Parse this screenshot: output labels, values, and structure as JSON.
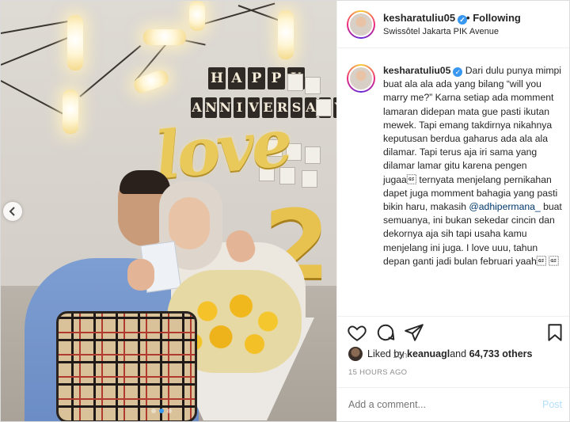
{
  "header": {
    "username": "kesharatuliu05",
    "separator": "•",
    "follow_status": "Following",
    "location": "Swissôtel Jakarta PIK Avenue"
  },
  "caption": {
    "username": "kesharatuliu05",
    "text_before_mention": "Dari dulu punya mimpi buat ala ala ada yang bilang “will you marry me?” Karna setiap ada momment lamaran didepan mata gue pasti ikutan mewek. Tapi emang takdirnya nikahnya keputusan berdua gaharus ada ala ala dilamar. Tapi terus aja iri sama yang dilamar lamar gitu karena pengen jugaa\u001d ternyata menjelang pernikahan dapet juga momment bahagia yang pasti bikin haru, makasih ",
    "mention": "@adhipermana_",
    "text_after_mention": " buat semuanya, ini bukan sekedar cincin dan dekornya aja sih tapi usaha kamu menjelang ini juga. I love uuu, tahun depan ganti jadi bulan februari yaah\u001d \u001d",
    "time": "15h"
  },
  "likes": {
    "prefix": "Liked by ",
    "user": "keanuagl",
    "middle": " and ",
    "count": "64,733 others"
  },
  "timestamp": "15 HOURS AGO",
  "comment": {
    "placeholder": "Add a comment...",
    "post_label": "Post"
  },
  "photo": {
    "banner_top": "HAPPY",
    "banner_bottom": "ANNIVERSARY",
    "balloon_word": "love",
    "balloon_number": "2",
    "carousel_dots": 3,
    "active_dot": 1
  },
  "icons": {
    "verified": "verified-badge-icon",
    "heart": "heart-icon",
    "comment": "comment-icon",
    "share": "share-icon",
    "save": "bookmark-icon",
    "prev": "chevron-left-icon"
  },
  "colors": {
    "accent": "#3897f0",
    "mention": "#00376b",
    "muted": "#8e8e8e",
    "post_disabled": "#b2dffc"
  }
}
